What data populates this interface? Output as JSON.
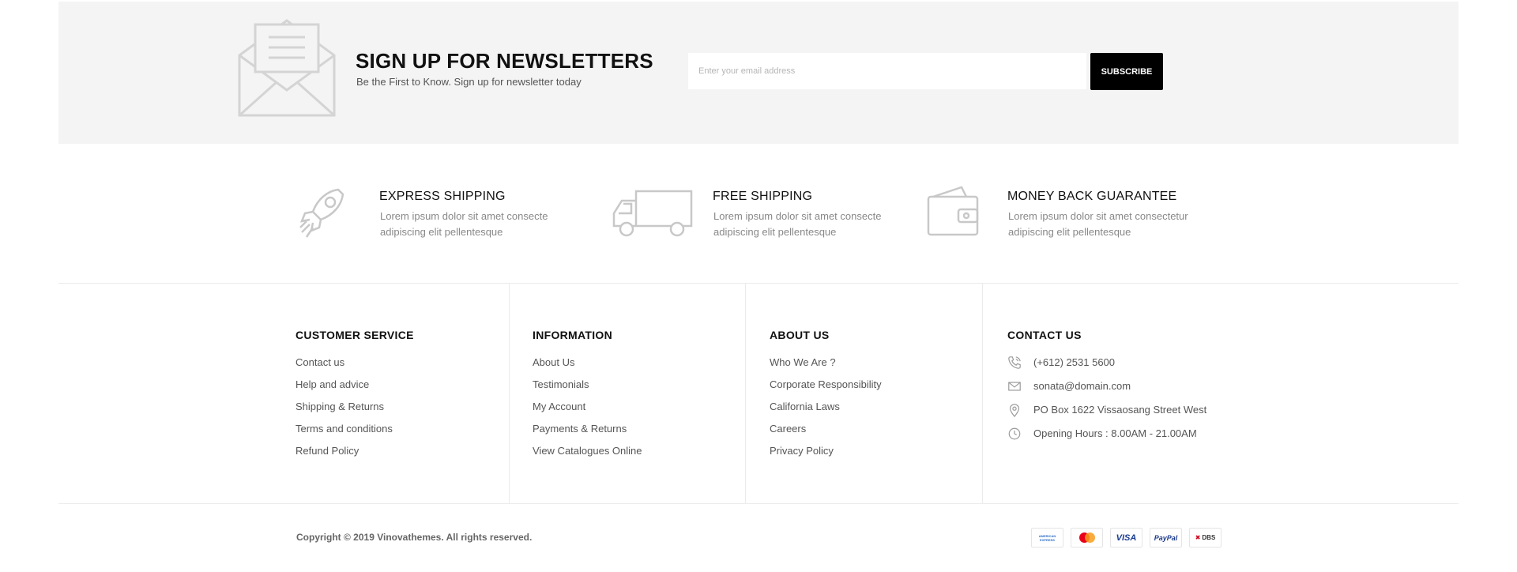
{
  "newsletter": {
    "icon": "envelope-open-icon",
    "title": "SIGN UP FOR NEWSLETTERS",
    "subtitle": "Be the First to Know. Sign up for newsletter today",
    "email_placeholder": "Enter your email address",
    "subscribe_label": "SUBSCRIBE"
  },
  "features": [
    {
      "icon": "rocket-icon",
      "title": "EXPRESS SHIPPING",
      "desc": "Lorem ipsum dolor sit amet consecte adipiscing elit pellentesque"
    },
    {
      "icon": "truck-icon",
      "title": "FREE SHIPPING",
      "desc": "Lorem ipsum dolor sit amet consecte adipiscing elit pellentesque"
    },
    {
      "icon": "wallet-icon",
      "title": "MONEY BACK GUARANTEE",
      "desc": "Lorem ipsum dolor sit amet consectetur adipiscing elit pellentesque"
    }
  ],
  "footer": {
    "customer_service": {
      "title": "CUSTOMER SERVICE",
      "links": [
        "Contact us",
        "Help and advice",
        "Shipping & Returns",
        "Terms and conditions",
        "Refund Policy"
      ]
    },
    "information": {
      "title": "INFORMATION",
      "links": [
        "About Us",
        "Testimonials",
        "My Account",
        "Payments & Returns",
        "View Catalogues Online"
      ]
    },
    "about_us": {
      "title": "ABOUT US",
      "links": [
        "Who We Are ?",
        "Corporate Responsibility",
        "California Laws",
        "Careers",
        "Privacy Policy"
      ]
    },
    "contact": {
      "title": "CONTACT US",
      "items": [
        {
          "icon": "phone-icon",
          "text": "(+612) 2531 5600"
        },
        {
          "icon": "mail-icon",
          "text": "sonata@domain.com"
        },
        {
          "icon": "map-pin-icon",
          "text": "PO Box 1622 Vissaosang Street West"
        },
        {
          "icon": "clock-icon",
          "text": "Opening Hours : 8.00AM - 21.00AM"
        }
      ]
    }
  },
  "bottom": {
    "copyright": "Copyright © 2019 Vinovathemes. All rights reserved.",
    "payments": [
      {
        "icon": "amex-icon",
        "label": "AMERICAN EXPRESS"
      },
      {
        "icon": "mastercard-icon",
        "label": ""
      },
      {
        "icon": "visa-icon",
        "label": "VISA"
      },
      {
        "icon": "paypal-icon",
        "label": "PayPal"
      },
      {
        "icon": "dbs-icon",
        "label": "DBS"
      }
    ]
  },
  "colors": {
    "newsletter_bg": "#f4f4f4",
    "button_bg": "#000000",
    "icon_gray": "#cfcfcf",
    "visa_blue": "#1a3d8f",
    "paypal_blue": "#1d3b8a",
    "dbs_red": "#d0021b",
    "mastercard_red": "#eb001b",
    "mastercard_orange": "#f79e1b"
  }
}
